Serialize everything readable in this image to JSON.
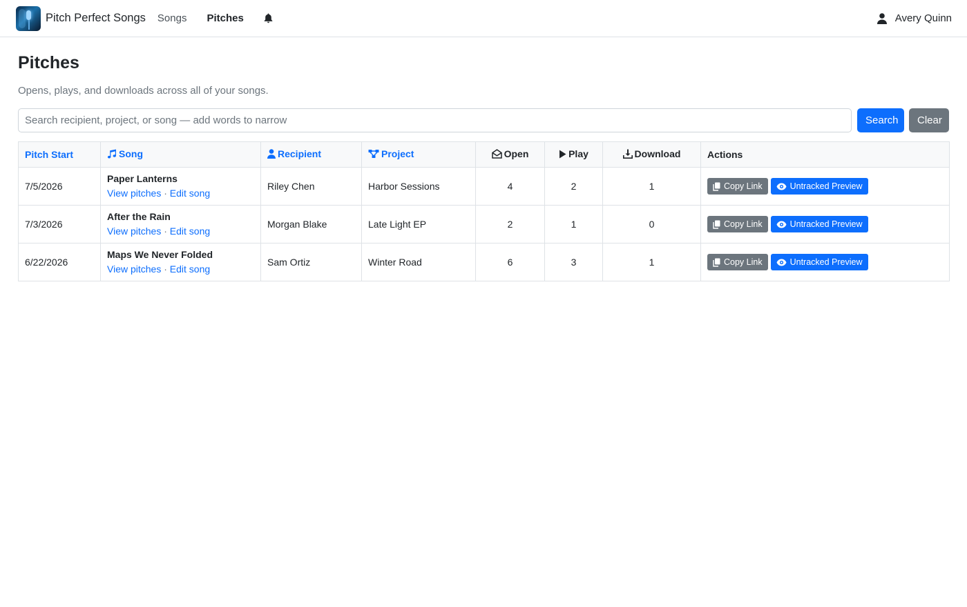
{
  "nav": {
    "brand": "Pitch Perfect Songs",
    "links": [
      "Songs",
      "Pitches"
    ],
    "user": "Avery Quinn"
  },
  "page": {
    "title": "Pitches",
    "subtitle": "Opens, plays, and downloads across all of your songs.",
    "search_placeholder": "Search recipient, project, or song — add words to narrow",
    "search_label": "Search",
    "clear_label": "Clear"
  },
  "table": {
    "headers": {
      "pitch_start": "Pitch Start",
      "song": "Song",
      "recipient": "Recipient",
      "project": "Project",
      "open": "Open",
      "play": "Play",
      "download": "Download",
      "actions": "Actions"
    },
    "link_labels": {
      "view": "View pitches",
      "sep": "·",
      "edit": "Edit song"
    },
    "action_labels": {
      "copy": "Copy Link",
      "preview": "Untracked Preview"
    },
    "rows": [
      {
        "date": "7/5/2026",
        "song": "Paper Lanterns",
        "recipient": "Riley Chen",
        "project": "Harbor Sessions",
        "open": "4",
        "play": "2",
        "download": "1"
      },
      {
        "date": "7/3/2026",
        "song": "After the Rain",
        "recipient": "Morgan Blake",
        "project": "Late Light EP",
        "open": "2",
        "play": "1",
        "download": "0"
      },
      {
        "date": "6/22/2026",
        "song": "Maps We Never Folded",
        "recipient": "Sam Ortiz",
        "project": "Winter Road",
        "open": "6",
        "play": "3",
        "download": "1"
      }
    ]
  },
  "colors": {
    "primary": "#0d6efd",
    "secondary": "#6c757d",
    "border": "#dee2e6"
  }
}
